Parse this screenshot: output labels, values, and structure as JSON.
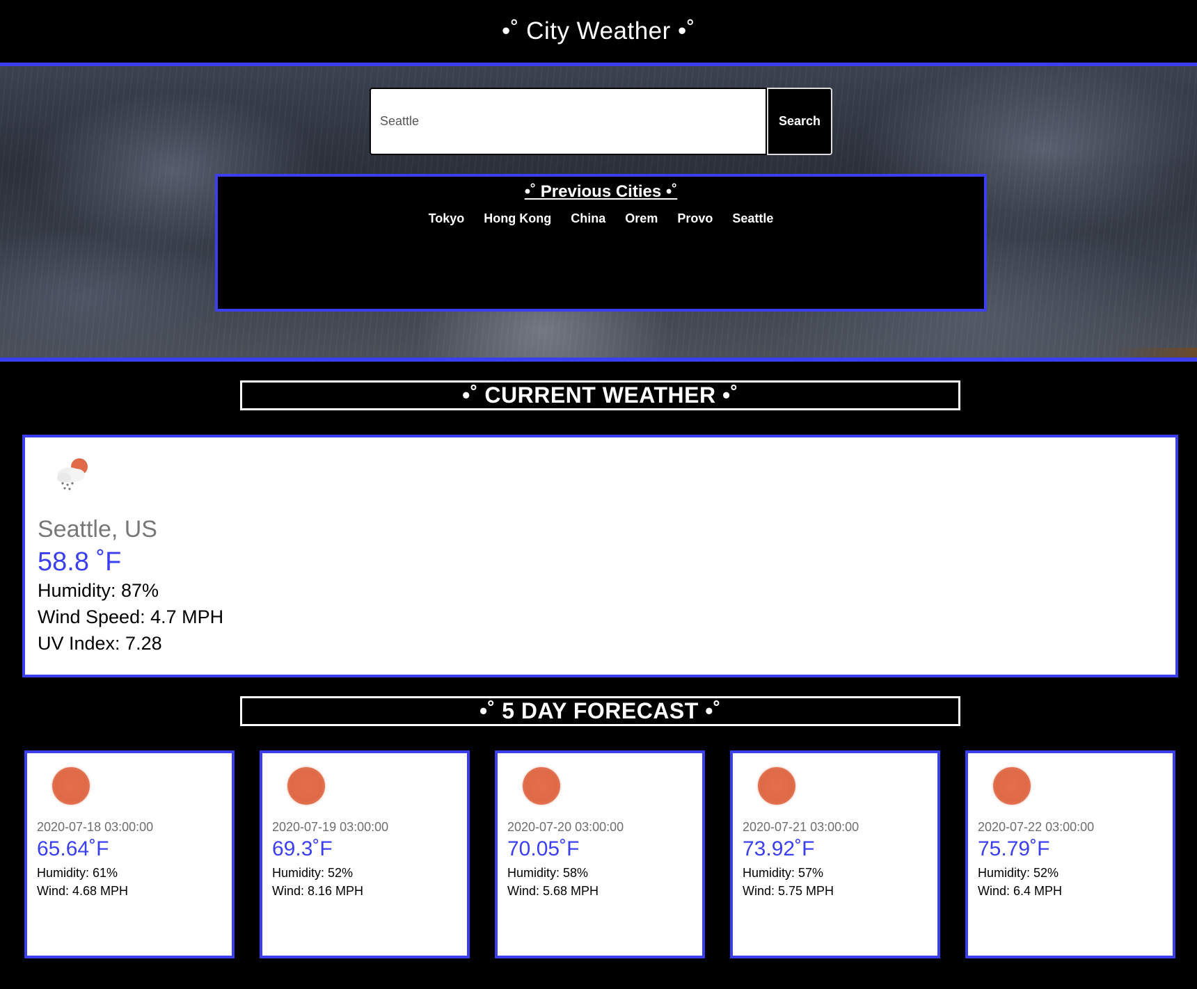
{
  "header": {
    "title": "•˚ City Weather •˚"
  },
  "search": {
    "placeholder": "Seattle",
    "button_label": "Search"
  },
  "previous": {
    "title": "•˚ Previous Cities •˚",
    "cities": [
      "Tokyo",
      "Hong Kong",
      "China",
      "Orem",
      "Provo",
      "Seattle"
    ]
  },
  "current": {
    "section_title": "•˚ CURRENT WEATHER •˚",
    "icon": "cloud-rain-sun-icon",
    "city": "Seattle, US",
    "temp": "58.8 ˚F",
    "humidity": "Humidity: 87%",
    "wind": "Wind Speed: 4.7 MPH",
    "uv": "UV Index: 7.28"
  },
  "forecast": {
    "section_title": "•˚ 5 DAY FORECAST •˚",
    "days": [
      {
        "icon": "sun-icon",
        "date": "2020-07-18 03:00:00",
        "temp": "65.64˚F",
        "humidity": "Humidity: 61%",
        "wind": "Wind: 4.68 MPH"
      },
      {
        "icon": "sun-icon",
        "date": "2020-07-19 03:00:00",
        "temp": "69.3˚F",
        "humidity": "Humidity: 52%",
        "wind": "Wind: 8.16 MPH"
      },
      {
        "icon": "sun-icon",
        "date": "2020-07-20 03:00:00",
        "temp": "70.05˚F",
        "humidity": "Humidity: 58%",
        "wind": "Wind: 5.68 MPH"
      },
      {
        "icon": "sun-icon",
        "date": "2020-07-21 03:00:00",
        "temp": "73.92˚F",
        "humidity": "Humidity: 57%",
        "wind": "Wind: 5.75 MPH"
      },
      {
        "icon": "sun-icon",
        "date": "2020-07-22 03:00:00",
        "temp": "75.79˚F",
        "humidity": "Humidity: 52%",
        "wind": "Wind: 6.4 MPH"
      }
    ]
  },
  "colors": {
    "accent": "#3b3ff0",
    "background": "#000000",
    "sun": "#df6a48"
  }
}
